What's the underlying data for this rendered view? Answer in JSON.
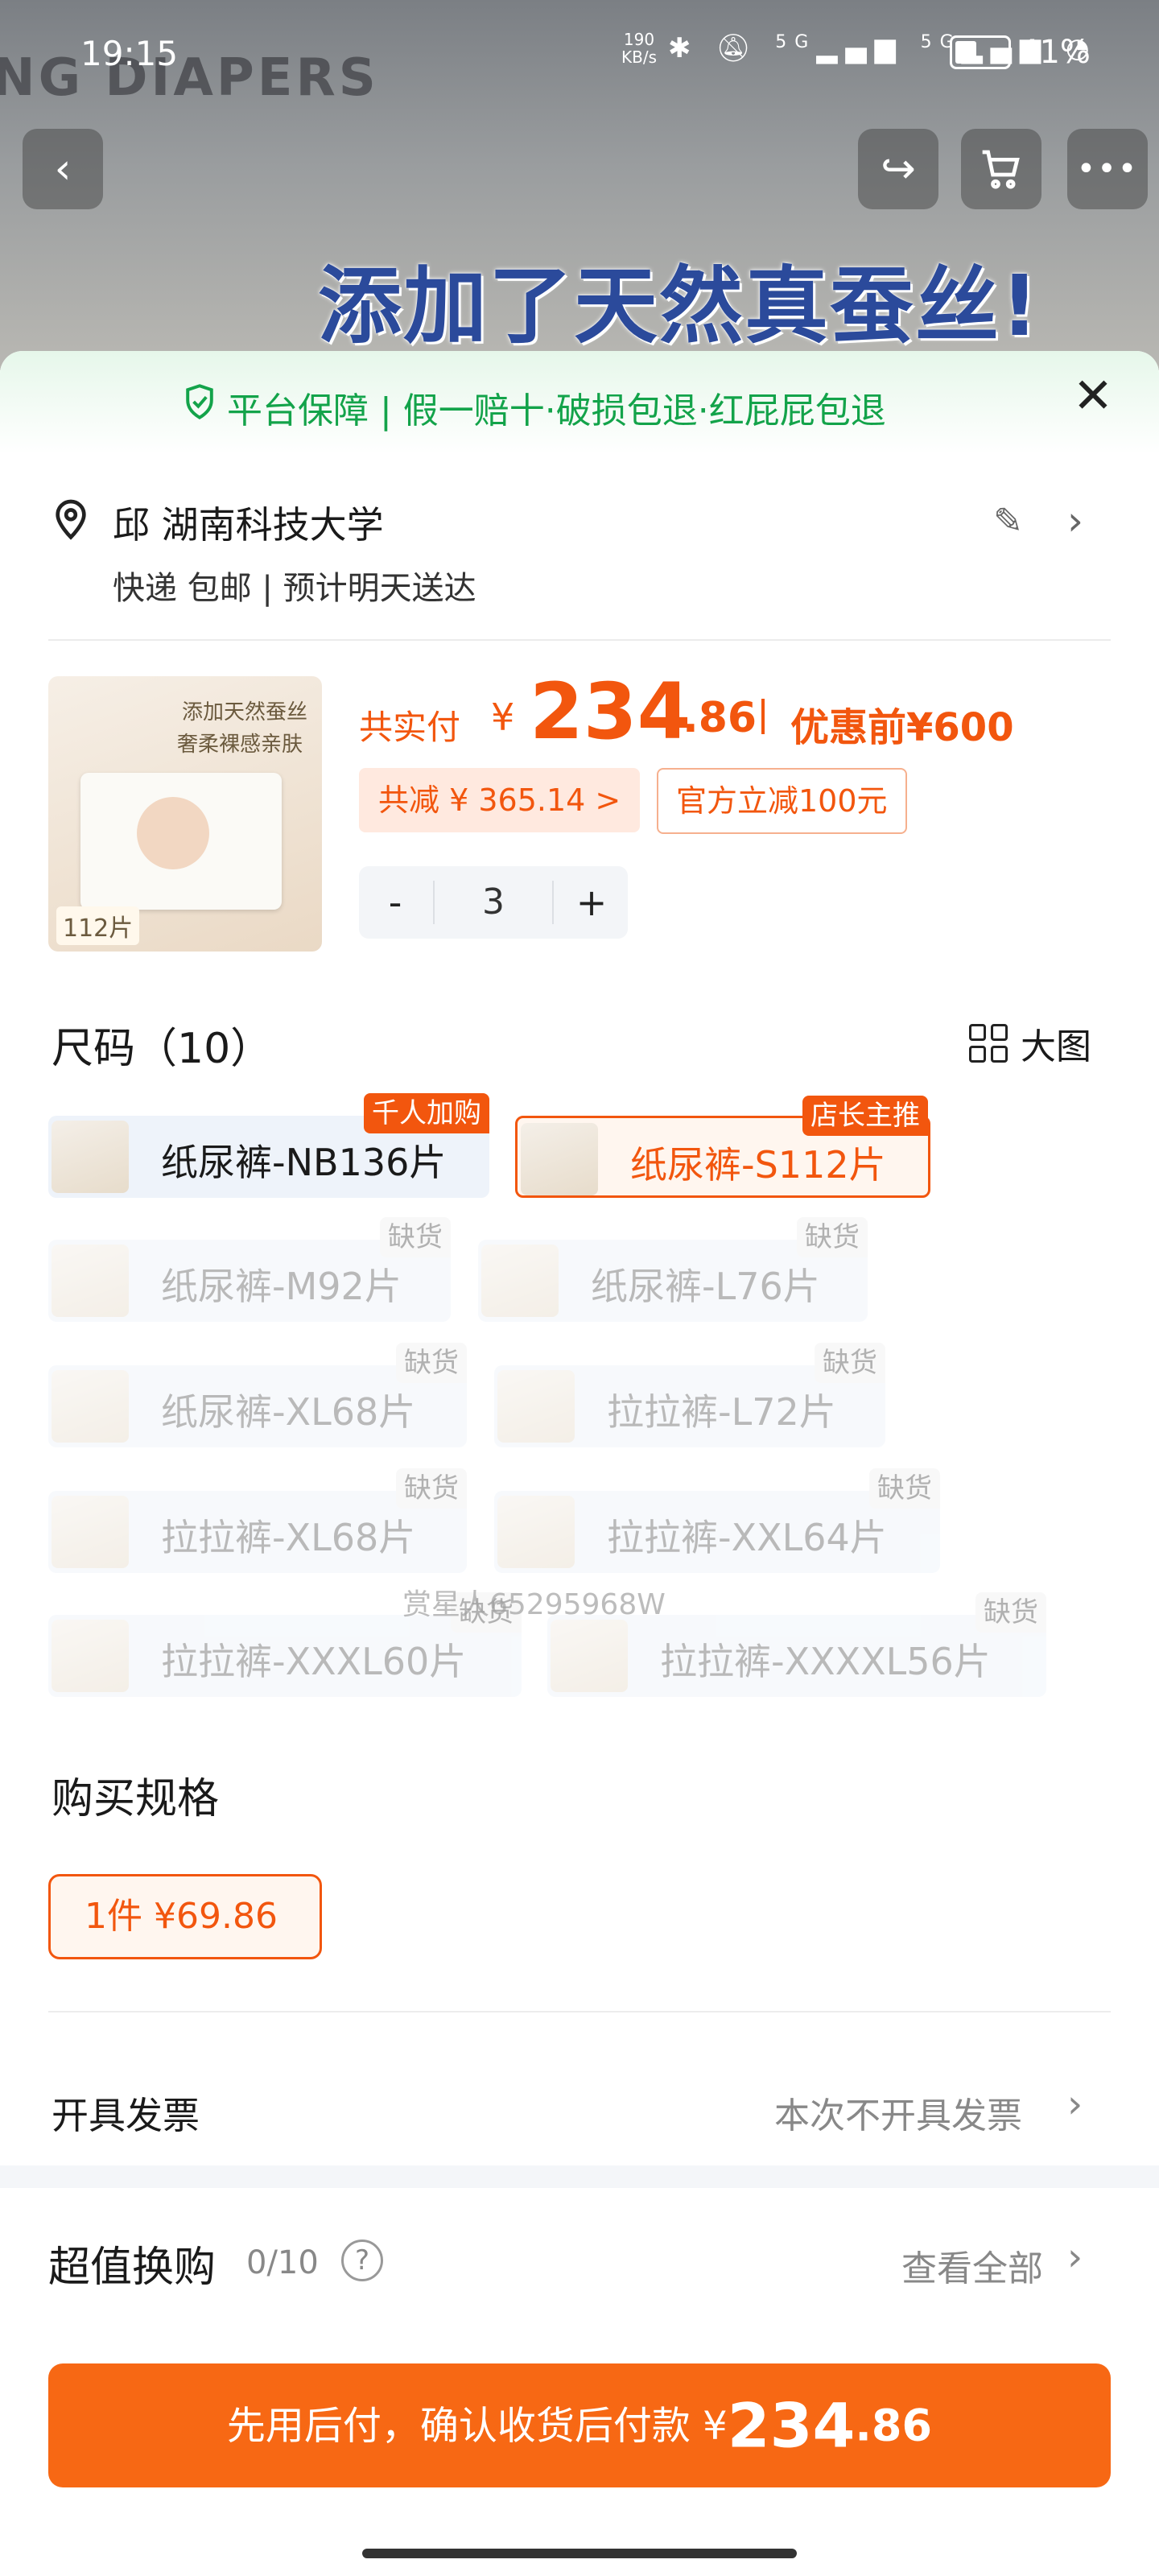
{
  "status_bar": {
    "time": "19:15",
    "net_speed": "190",
    "net_unit": "KB/s",
    "net1": "5G",
    "net2": "5G",
    "battery": "41%"
  },
  "banner": {
    "brand_text": "NG DIAPERS",
    "headline": "添加了天然真蚕丝!"
  },
  "guarantee": {
    "text": "平台保障 | 假一赔十·破损包退·红屁屁包退"
  },
  "address": {
    "name": "邱 湖南科技大学",
    "shipping": "快递 包邮 | 预计明天送达"
  },
  "product": {
    "thumb_line1": "添加天然蚕丝",
    "thumb_line2": "奢柔裸感亲肤",
    "thumb_count": "112片",
    "price_label": "共实付",
    "currency": "¥",
    "price_int": "234",
    "price_dec": ".86",
    "original": "优惠前¥600",
    "save_chip": "共减 ¥ 365.14 >",
    "official_chip": "官方立减100元",
    "qty": "3",
    "minus": "-",
    "plus": "+"
  },
  "size_section": {
    "title": "尺码（10）",
    "big_view": "大图",
    "options": [
      {
        "label": "纸尿裤-NB136片",
        "tag": "千人加购",
        "state": "normal"
      },
      {
        "label": "纸尿裤-S112片",
        "tag": "店长主推",
        "state": "selected"
      },
      {
        "label": "纸尿裤-M92片",
        "tag": "缺货",
        "state": "disabled"
      },
      {
        "label": "纸尿裤-L76片",
        "tag": "缺货",
        "state": "disabled"
      },
      {
        "label": "纸尿裤-XL68片",
        "tag": "缺货",
        "state": "disabled"
      },
      {
        "label": "拉拉裤-L72片",
        "tag": "缺货",
        "state": "disabled"
      },
      {
        "label": "拉拉裤-XL68片",
        "tag": "缺货",
        "state": "disabled"
      },
      {
        "label": "拉拉裤-XXL64片",
        "tag": "缺货",
        "state": "disabled"
      },
      {
        "label": "拉拉裤-XXXL60片",
        "tag": "缺货",
        "state": "disabled"
      },
      {
        "label": "拉拉裤-XXXXL56片",
        "tag": "缺货",
        "state": "disabled"
      }
    ],
    "watermark": "赏星人65295968W"
  },
  "spec_section": {
    "title": "购买规格",
    "option": "1件 ¥69.86"
  },
  "invoice": {
    "label": "开具发票",
    "value": "本次不开具发票"
  },
  "exchange": {
    "title": "超值换购",
    "count": "0/10",
    "help": "?",
    "view_all": "查看全部"
  },
  "cta": {
    "text": "先用后付，确认收货后付款 ¥",
    "amount_int": "234",
    "amount_dec": ".86"
  },
  "colors": {
    "accent": "#f2560e",
    "cta": "#f76814",
    "guarantee_green": "#13a34a"
  }
}
